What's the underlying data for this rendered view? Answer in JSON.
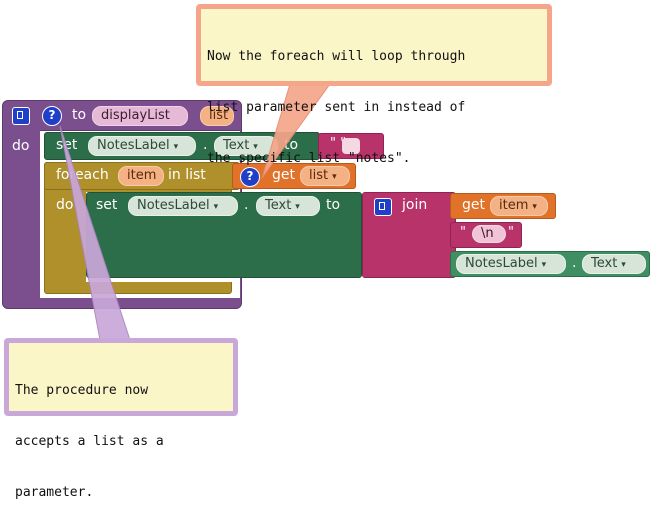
{
  "callout_top": {
    "lines": [
      "Now the foreach will loop through",
      "list parameter sent in instead of",
      "the specific list \"notes\"."
    ]
  },
  "callout_bottom": {
    "lines": [
      "The procedure now",
      "accepts a list as a",
      "parameter."
    ]
  },
  "procedure": {
    "to_label": "to",
    "name": "displayList",
    "param": "list",
    "do_label": "do"
  },
  "set1": {
    "set_label": "set",
    "component": "NotesLabel",
    "dot": ".",
    "property": "Text",
    "to_label": "to",
    "value": "\" \""
  },
  "foreach": {
    "label_prefix": "foreach",
    "var": "item",
    "in_list_label": "in list",
    "get_label": "get",
    "get_var": "list",
    "do_label": "do"
  },
  "set2": {
    "set_label": "set",
    "component": "NotesLabel",
    "dot": ".",
    "property": "Text",
    "to_label": "to"
  },
  "join": {
    "label": "join",
    "get_label": "get",
    "get_var": "item",
    "newline_text": "\\n",
    "component": "NotesLabel",
    "dot": ".",
    "property": "Text"
  },
  "colors": {
    "procedure": "#7b4f8e",
    "set_block": "#2c6e49",
    "control": "#b0902a",
    "variable": "#e0722a",
    "text": "#b8336a",
    "component": "#3f8f63",
    "callout_top_bg": "#fbe2c7",
    "callout_bottom_bg": "#c9a7d9"
  },
  "icons": [
    "mutator-icon",
    "question-icon",
    "dropdown-triangle-icon"
  ]
}
